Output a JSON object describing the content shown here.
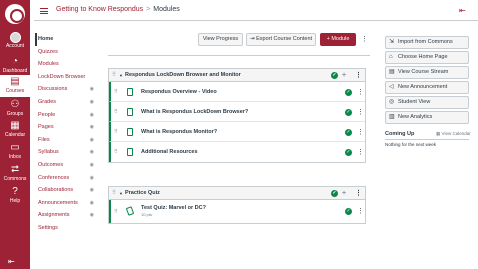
{
  "global_nav": {
    "items": [
      {
        "label": "Account",
        "icon": "account-avatar"
      },
      {
        "label": "Dashboard",
        "icon": "dashboard-icon"
      },
      {
        "label": "Courses",
        "icon": "courses-icon"
      },
      {
        "label": "Groups",
        "icon": "groups-icon"
      },
      {
        "label": "Calendar",
        "icon": "calendar-icon"
      },
      {
        "label": "Inbox",
        "icon": "inbox-icon"
      },
      {
        "label": "Commons",
        "icon": "commons-icon"
      },
      {
        "label": "Help",
        "icon": "help-icon"
      }
    ],
    "active_item": "Courses",
    "color": "#9e2235"
  },
  "header": {
    "course_link": "Getting to Know Respondus",
    "separator": ">",
    "current_page": "Modules"
  },
  "course_nav": {
    "items": [
      {
        "label": "Home",
        "hidden": false,
        "active": true
      },
      {
        "label": "Quizzes",
        "hidden": false
      },
      {
        "label": "Modules",
        "hidden": false
      },
      {
        "label": "LockDown Browser",
        "hidden": false
      },
      {
        "label": "Discussions",
        "hidden": true
      },
      {
        "label": "Grades",
        "hidden": true
      },
      {
        "label": "People",
        "hidden": true
      },
      {
        "label": "Pages",
        "hidden": true
      },
      {
        "label": "Files",
        "hidden": true
      },
      {
        "label": "Syllabus",
        "hidden": true
      },
      {
        "label": "Outcomes",
        "hidden": true
      },
      {
        "label": "Conferences",
        "hidden": true
      },
      {
        "label": "Collaborations",
        "hidden": true
      },
      {
        "label": "Announcements",
        "hidden": true
      },
      {
        "label": "Assignments",
        "hidden": true
      },
      {
        "label": "Settings",
        "hidden": false
      }
    ]
  },
  "toolbar": {
    "view_progress": "View Progress",
    "export_content": "Export Course Content",
    "add_module": "Module"
  },
  "modules": [
    {
      "title": "Respondus LockDown Browser and Monitor",
      "published": true,
      "items": [
        {
          "title": "Respondus Overview - Video",
          "published": true
        },
        {
          "title": "What is Respondus LockDown Browser?",
          "published": true
        },
        {
          "title": "What is Respondus Monitor?",
          "published": true
        },
        {
          "title": "Additional Resources",
          "published": true
        }
      ]
    },
    {
      "title": "Practice Quiz",
      "published": true,
      "items": [
        {
          "title": "Test Quiz: Marvel or DC?",
          "subtitle": "10 pts",
          "published": true
        }
      ]
    }
  ],
  "sidebar": {
    "buttons": [
      {
        "label": "Import from Commons",
        "icon": "import-icon"
      },
      {
        "label": "Choose Home Page",
        "icon": "home-icon"
      },
      {
        "label": "View Course Stream",
        "icon": "stream-icon"
      },
      {
        "label": "New Announcement",
        "icon": "announcement-icon"
      },
      {
        "label": "Student View",
        "icon": "student-view-icon"
      },
      {
        "label": "New Analytics",
        "icon": "analytics-icon"
      }
    ],
    "coming_up": {
      "title": "Coming Up",
      "view_calendar": "View Calendar",
      "empty_text": "Nothing for the next week"
    }
  },
  "colors": {
    "brand": "#9e2235",
    "published": "#0b874b",
    "text": "#2d3b45"
  }
}
